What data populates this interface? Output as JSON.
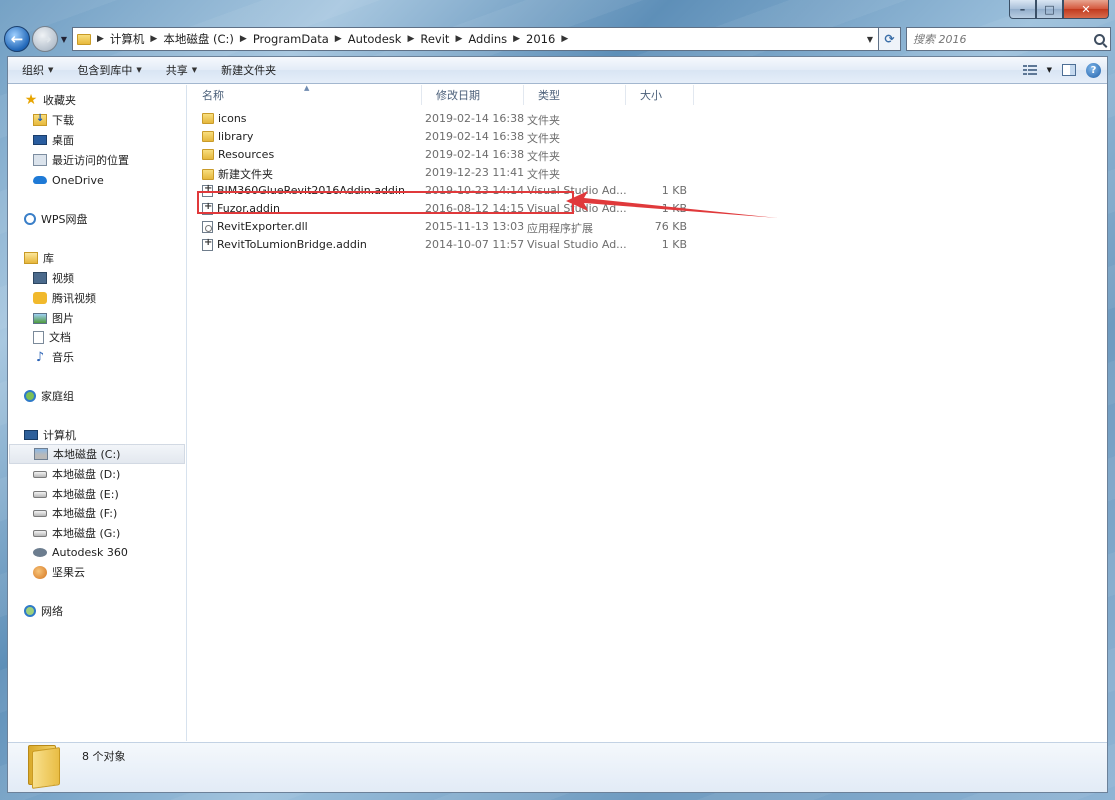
{
  "address": {
    "crumbs": [
      "计算机",
      "本地磁盘 (C:)",
      "ProgramData",
      "Autodesk",
      "Revit",
      "Addins",
      "2016"
    ],
    "search_placeholder": "搜索 2016"
  },
  "toolbar": {
    "organize": "组织",
    "include_in_library": "包含到库中",
    "share": "共享",
    "new_folder": "新建文件夹"
  },
  "nav": {
    "favorites": "收藏夹",
    "downloads": "下载",
    "desktop": "桌面",
    "recent": "最近访问的位置",
    "onedrive": "OneDrive",
    "wps": "WPS网盘",
    "libraries": "库",
    "videos": "视频",
    "tencent_video": "腾讯视频",
    "pictures": "图片",
    "documents": "文档",
    "music": "音乐",
    "homegroup": "家庭组",
    "computer": "计算机",
    "drive_c": "本地磁盘 (C:)",
    "drive_d": "本地磁盘 (D:)",
    "drive_e": "本地磁盘 (E:)",
    "drive_f": "本地磁盘 (F:)",
    "drive_g": "本地磁盘 (G:)",
    "autodesk360": "Autodesk 360",
    "jianguoyun": "坚果云",
    "network": "网络"
  },
  "columns": {
    "name": "名称",
    "modified": "修改日期",
    "type": "类型",
    "size": "大小"
  },
  "files": [
    {
      "name": "icons",
      "date": "2019-02-14 16:38",
      "type": "文件夹",
      "size": "",
      "icon": "folder-icon"
    },
    {
      "name": "library",
      "date": "2019-02-14 16:38",
      "type": "文件夹",
      "size": "",
      "icon": "folder-icon"
    },
    {
      "name": "Resources",
      "date": "2019-02-14 16:38",
      "type": "文件夹",
      "size": "",
      "icon": "folder-icon"
    },
    {
      "name": "新建文件夹",
      "date": "2019-12-23 11:41",
      "type": "文件夹",
      "size": "",
      "icon": "folder-icon"
    },
    {
      "name": "BIM360GlueRevit2016Addin.addin",
      "date": "2019-10-23 14:14",
      "type": "Visual Studio Ad...",
      "size": "1 KB",
      "icon": "addin-file-icon"
    },
    {
      "name": "Fuzor.addin",
      "date": "2016-08-12 14:15",
      "type": "Visual Studio Ad...",
      "size": "1 KB",
      "icon": "addin-file-icon"
    },
    {
      "name": "RevitExporter.dll",
      "date": "2015-11-13 13:03",
      "type": "应用程序扩展",
      "size": "76 KB",
      "icon": "dll-file-icon"
    },
    {
      "name": "RevitToLumionBridge.addin",
      "date": "2014-10-07 11:57",
      "type": "Visual Studio Ad...",
      "size": "1 KB",
      "icon": "addin-file-icon"
    }
  ],
  "status": {
    "object_count": "8 个对象"
  },
  "annotation": {
    "highlight_color": "#e0393b"
  }
}
